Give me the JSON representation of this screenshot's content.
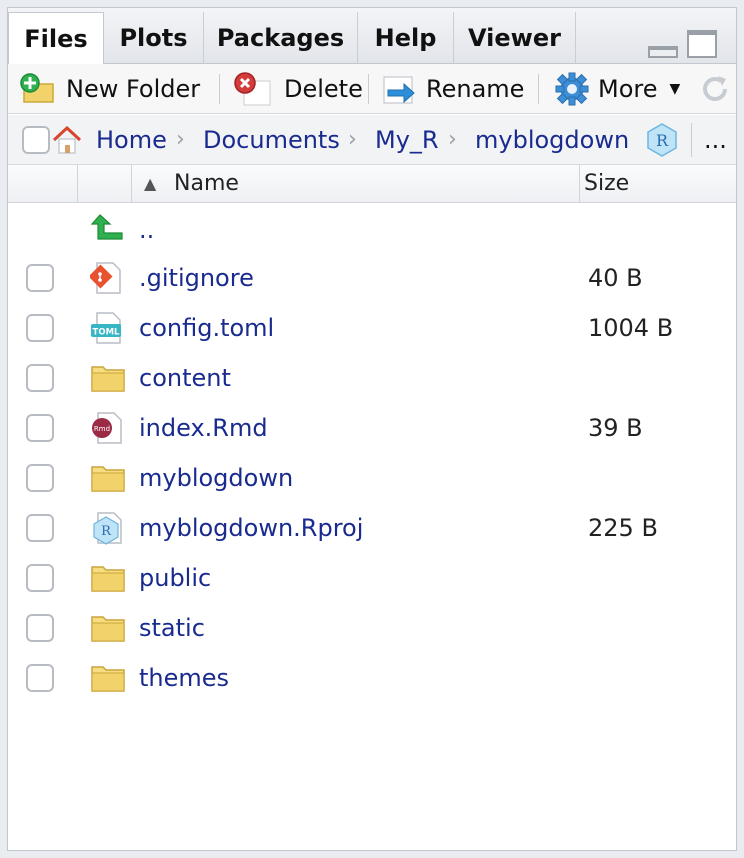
{
  "tabs": [
    {
      "label": "Files"
    },
    {
      "label": "Plots"
    },
    {
      "label": "Packages"
    },
    {
      "label": "Help"
    },
    {
      "label": "Viewer"
    }
  ],
  "toolbar": {
    "new_folder": "New Folder",
    "delete": "Delete",
    "rename": "Rename",
    "more": "More"
  },
  "breadcrumb": {
    "items": [
      "Home",
      "Documents",
      "My_R",
      "myblogdown"
    ],
    "overflow": "..."
  },
  "columns": {
    "name": "Name",
    "size": "Size"
  },
  "parent_dir": "..",
  "files": [
    {
      "name": ".gitignore",
      "size": "40 B",
      "icon": "git-file-icon"
    },
    {
      "name": "config.toml",
      "size": "1004 B",
      "icon": "toml-file-icon"
    },
    {
      "name": "content",
      "size": "",
      "icon": "folder-icon"
    },
    {
      "name": "index.Rmd",
      "size": "39 B",
      "icon": "rmd-file-icon"
    },
    {
      "name": "myblogdown",
      "size": "",
      "icon": "folder-icon"
    },
    {
      "name": "myblogdown.Rproj",
      "size": "225 B",
      "icon": "rproj-file-icon"
    },
    {
      "name": "public",
      "size": "",
      "icon": "folder-icon"
    },
    {
      "name": "static",
      "size": "",
      "icon": "folder-icon"
    },
    {
      "name": "themes",
      "size": "",
      "icon": "folder-icon"
    }
  ],
  "colors": {
    "link": "#1a2b8f",
    "folder": "#f2d36b",
    "accent_green": "#2fb14f"
  }
}
